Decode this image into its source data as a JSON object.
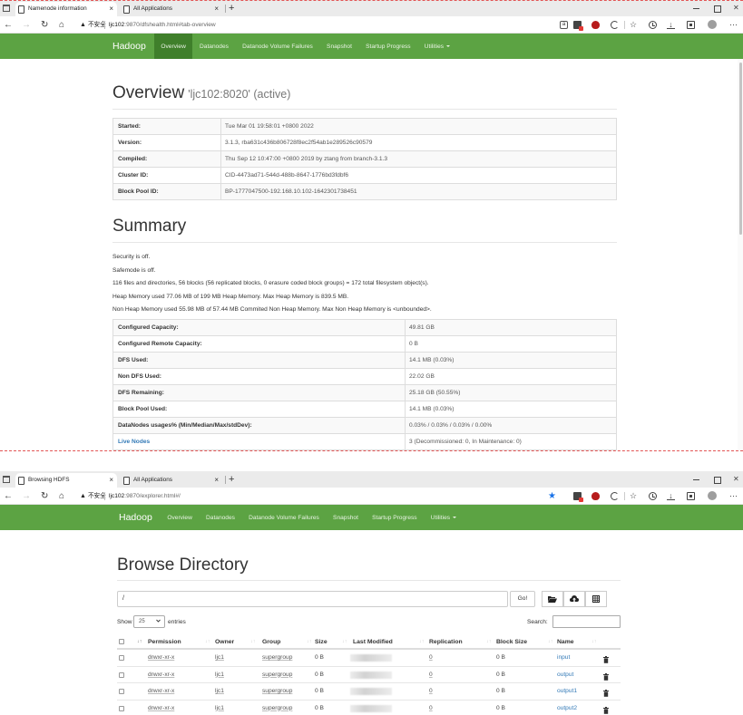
{
  "colors": {
    "navbar": "#5ca343",
    "navbar_active": "#3f7f2b",
    "link": "#337ab7",
    "favorite_star": "#1a73e8"
  },
  "top": {
    "tabs": [
      {
        "label": "Namenode information"
      },
      {
        "label": "All Applications"
      }
    ],
    "address": {
      "warning": "不安全",
      "host": "ljc102",
      "path": ":9870/dfshealth.html#tab-overview"
    },
    "nav": {
      "brand": "Hadoop",
      "items": [
        {
          "label": "Overview",
          "active": true
        },
        {
          "label": "Datanodes"
        },
        {
          "label": "Datanode Volume Failures"
        },
        {
          "label": "Snapshot"
        },
        {
          "label": "Startup Progress"
        },
        {
          "label": "Utilities",
          "dropdown": true
        }
      ]
    },
    "overview": {
      "title": "Overview",
      "subtitle": "'ljc102:8020' (active)",
      "rows": [
        {
          "label": "Started:",
          "value": "Tue Mar 01 19:58:01 +0800 2022"
        },
        {
          "label": "Version:",
          "value": "3.1.3, rba631c436b806728f8ec2f54ab1e289526c90579"
        },
        {
          "label": "Compiled:",
          "value": "Thu Sep 12 10:47:00 +0800 2019 by ztang from branch-3.1.3"
        },
        {
          "label": "Cluster ID:",
          "value": "CID-4473ad71-544d-488b-8647-1776bd3fdbf6"
        },
        {
          "label": "Block Pool ID:",
          "value": "BP-1777047500-192.168.10.102-1642301738451"
        }
      ]
    },
    "summary": {
      "title": "Summary",
      "lines": [
        "Security is off.",
        "Safemode is off.",
        "116 files and directories, 56 blocks (56 replicated blocks, 0 erasure coded block groups) = 172 total filesystem object(s).",
        "Heap Memory used 77.06 MB of 199 MB Heap Memory. Max Heap Memory is 839.5 MB.",
        "Non Heap Memory used 55.98 MB of 57.44 MB Commited Non Heap Memory. Max Non Heap Memory is <unbounded>."
      ],
      "rows": [
        {
          "label": "Configured Capacity:",
          "value": "49.81 GB"
        },
        {
          "label": "Configured Remote Capacity:",
          "value": "0 B"
        },
        {
          "label": "DFS Used:",
          "value": "14.1 MB (0.03%)"
        },
        {
          "label": "Non DFS Used:",
          "value": "22.02 GB"
        },
        {
          "label": "DFS Remaining:",
          "value": "25.18 GB (50.55%)"
        },
        {
          "label": "Block Pool Used:",
          "value": "14.1 MB (0.03%)"
        },
        {
          "label": "DataNodes usages% (Min/Median/Max/stdDev):",
          "value": "0.03% / 0.03% / 0.03% / 0.00%"
        },
        {
          "label": "Live Nodes",
          "value": "3 (Decommissioned: 0, In Maintenance: 0)",
          "link": true
        }
      ]
    }
  },
  "bottom": {
    "tabs": [
      {
        "label": "Browsing HDFS"
      },
      {
        "label": "All Applications"
      }
    ],
    "address": {
      "warning": "不安全",
      "host": "ljc102",
      "path": ":9870/explorer.html#/"
    },
    "nav": {
      "brand": "Hadoop",
      "items": [
        {
          "label": "Overview"
        },
        {
          "label": "Datanodes"
        },
        {
          "label": "Datanode Volume Failures"
        },
        {
          "label": "Snapshot"
        },
        {
          "label": "Startup Progress"
        },
        {
          "label": "Utilities",
          "dropdown": true
        }
      ]
    },
    "browse": {
      "title": "Browse Directory",
      "path": "/",
      "go": "Go!",
      "show": "Show",
      "page_length": "25",
      "entries": "entries",
      "search_label": "Search:",
      "columns": [
        "Permission",
        "Owner",
        "Group",
        "Size",
        "Last Modified",
        "Replication",
        "Block Size",
        "Name"
      ],
      "rows": [
        {
          "permission": "drwxr-xr-x",
          "owner": "ljc1",
          "group": "supergroup",
          "size": "0 B",
          "replication": "0",
          "block_size": "0 B",
          "name": "input"
        },
        {
          "permission": "drwxr-xr-x",
          "owner": "ljc1",
          "group": "supergroup",
          "size": "0 B",
          "replication": "0",
          "block_size": "0 B",
          "name": "output"
        },
        {
          "permission": "drwxr-xr-x",
          "owner": "ljc1",
          "group": "supergroup",
          "size": "0 B",
          "replication": "0",
          "block_size": "0 B",
          "name": "output1"
        },
        {
          "permission": "drwxr-xr-x",
          "owner": "ljc1",
          "group": "supergroup",
          "size": "0 B",
          "replication": "0",
          "block_size": "0 B",
          "name": "output2"
        }
      ]
    }
  }
}
